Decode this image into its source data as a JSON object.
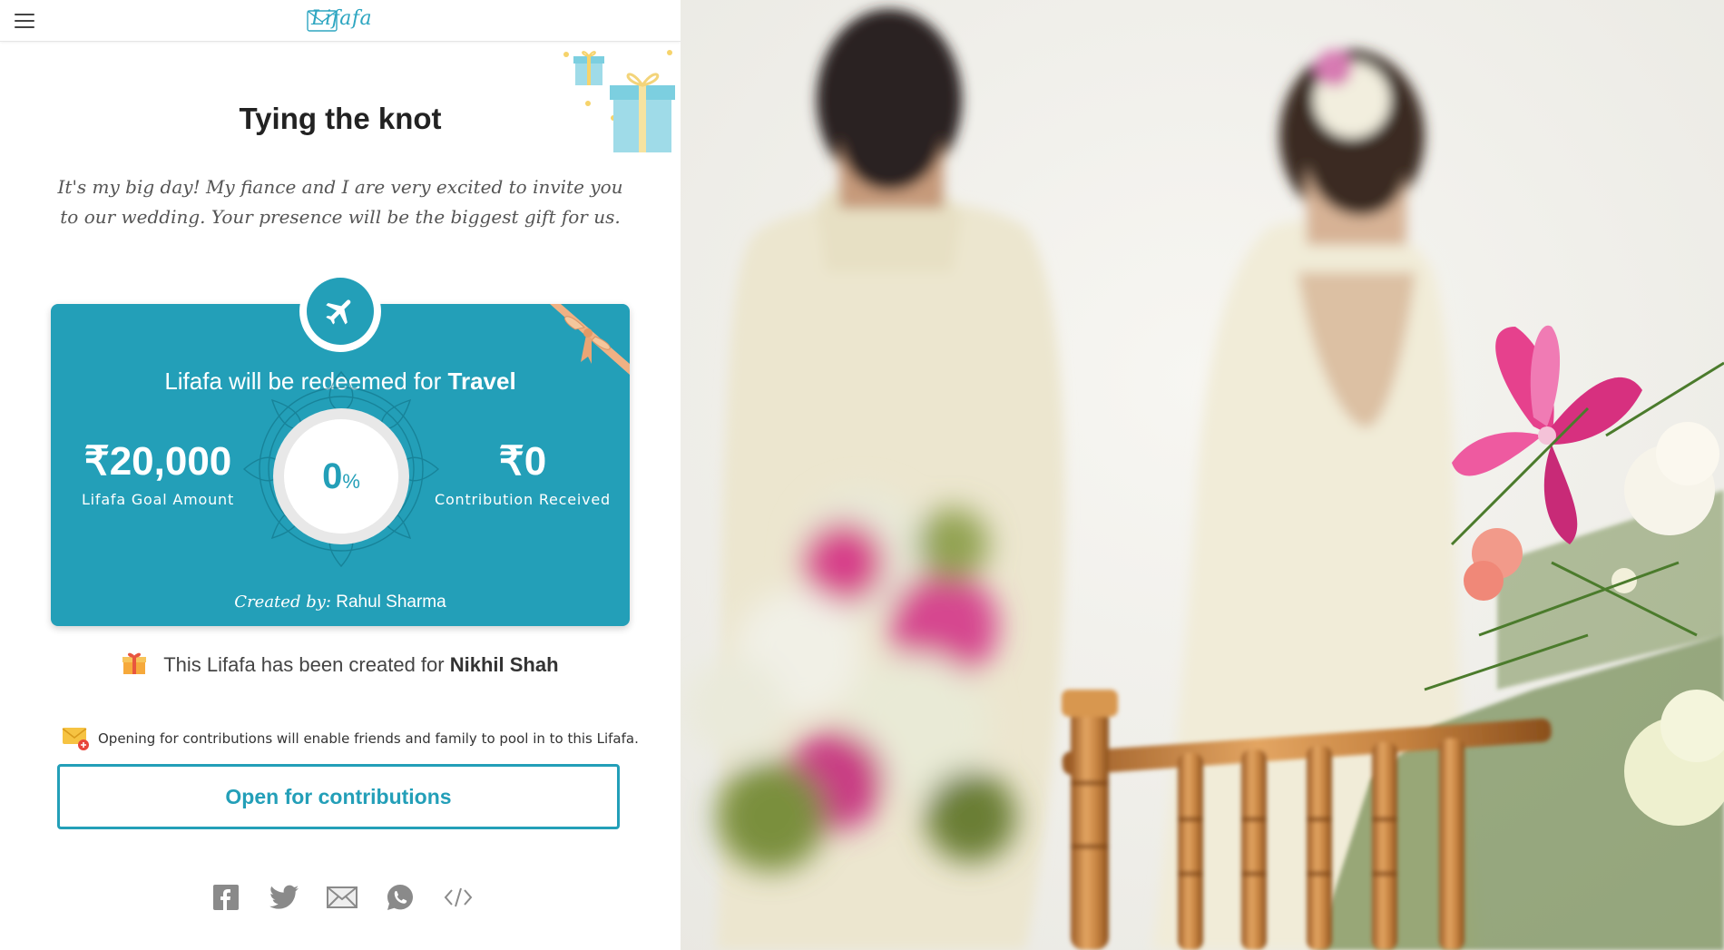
{
  "header": {
    "logo_text": "Lifafa",
    "menu_icon": "hamburger-menu-icon"
  },
  "event": {
    "title": "Tying the knot",
    "message": "It's my big day! My fiance and I are very excited to invite you to our wedding. Your presence will be the biggest gift for us."
  },
  "card": {
    "icon": "airplane-icon",
    "redeem_prefix": "Lifafa will be redeemed for",
    "redeem_category": "Travel",
    "goal_amount": "₹20,000",
    "goal_label": "Lifafa Goal Amount",
    "progress_value": "0",
    "progress_unit": "%",
    "progress_fraction": 0,
    "received_amount": "₹0",
    "received_label": "Contribution Received",
    "created_by_label": "Created by:",
    "created_by_name": "Rahul Sharma",
    "accent_color": "#239fb8"
  },
  "recipient": {
    "prefix": "This Lifafa has been created for",
    "name": "Nikhil Shah"
  },
  "contributions": {
    "hint": "Opening for contributions will enable friends and family to pool in to this Lifafa.",
    "button_label": "Open for contributions"
  },
  "share": {
    "icons": [
      "facebook-icon",
      "twitter-icon",
      "email-icon",
      "whatsapp-icon",
      "embed-code-icon"
    ]
  }
}
